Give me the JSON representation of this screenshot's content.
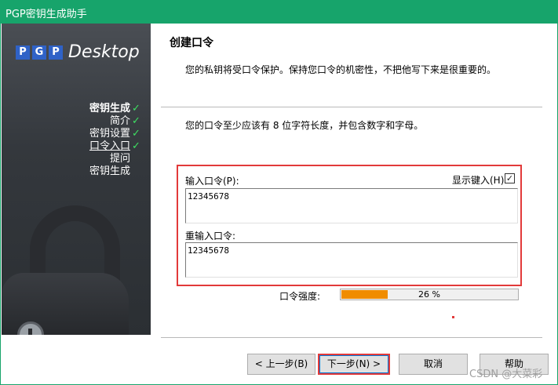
{
  "window": {
    "title": "PGP密钥生成助手"
  },
  "sidebar": {
    "logo_letters": [
      "P",
      "G",
      "P"
    ],
    "logo_text": "Desktop",
    "steps": [
      {
        "label": "密钥生成",
        "checked": true,
        "bold": true,
        "underline": false
      },
      {
        "label": "简介",
        "checked": true,
        "bold": false,
        "underline": false
      },
      {
        "label": "密钥设置",
        "checked": true,
        "bold": false,
        "underline": false
      },
      {
        "label": "口令入口",
        "checked": true,
        "bold": false,
        "underline": true
      },
      {
        "label": "提问",
        "checked": false,
        "bold": false,
        "underline": false
      },
      {
        "label": "密钥生成",
        "checked": false,
        "bold": false,
        "underline": false
      }
    ],
    "check_glyph": "✓"
  },
  "main": {
    "heading": "创建口令",
    "description": "您的私钥将受口令保护。保持您口令的机密性，不把他写下来是很重要的。",
    "requirement": "您的口令至少应该有 8 位字符长度，并包含数字和字母。",
    "password_label": "输入口令(P):",
    "password_value": "12345678",
    "show_typing_label": "显示键入(H)",
    "show_typing_checked": true,
    "show_typing_glyph": "✓",
    "confirm_label": "重输入口令:",
    "confirm_value": "12345678",
    "strength_label": "口令强度:",
    "strength_percent": 26,
    "strength_text": "26 %",
    "accent_color": "#f08c00"
  },
  "buttons": {
    "back": "< 上一步(B)",
    "next": "下一步(N) >",
    "cancel": "取消",
    "help": "帮助"
  },
  "watermark": "CSDN @大菜彩"
}
